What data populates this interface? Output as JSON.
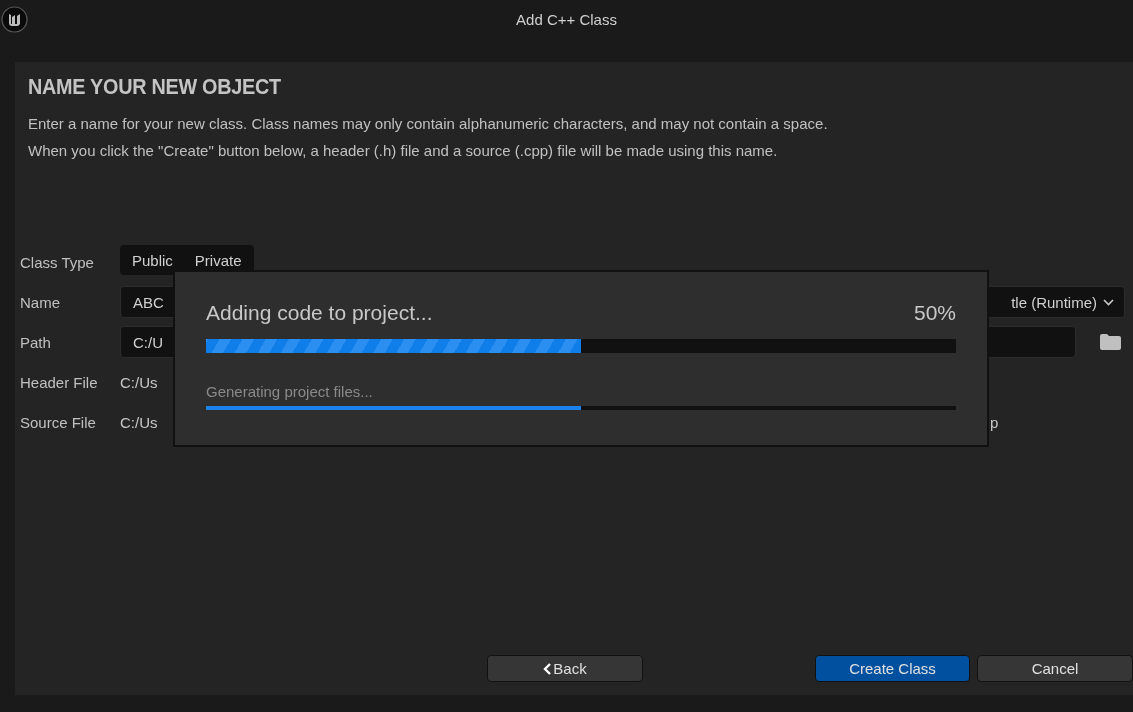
{
  "window": {
    "title": "Add C++ Class"
  },
  "heading": "NAME YOUR NEW OBJECT",
  "description": [
    "Enter a name for your new class. Class names may only contain alphanumeric characters, and may not contain a space.",
    "When you click the \"Create\" button below, a header (.h) file and a source (.cpp) file will be made using this name."
  ],
  "form": {
    "class_type": {
      "label": "Class Type",
      "options": [
        "Public",
        "Private"
      ]
    },
    "name": {
      "label": "Name",
      "value": "ABC",
      "module": "tle (Runtime)"
    },
    "path": {
      "label": "Path",
      "value": "C:/U"
    },
    "header_file": {
      "label": "Header File",
      "value": "C:/Us"
    },
    "source_file": {
      "label": "Source File",
      "value": "C:/Us",
      "value_end": "p"
    }
  },
  "progress": {
    "title": "Adding code to project...",
    "percent": "50%",
    "level": 0.5,
    "status": "Generating project files...",
    "status_bar": {
      "level": 0.5
    }
  },
  "buttons": {
    "back": "Back",
    "create": "Create Class",
    "cancel": "Cancel"
  }
}
